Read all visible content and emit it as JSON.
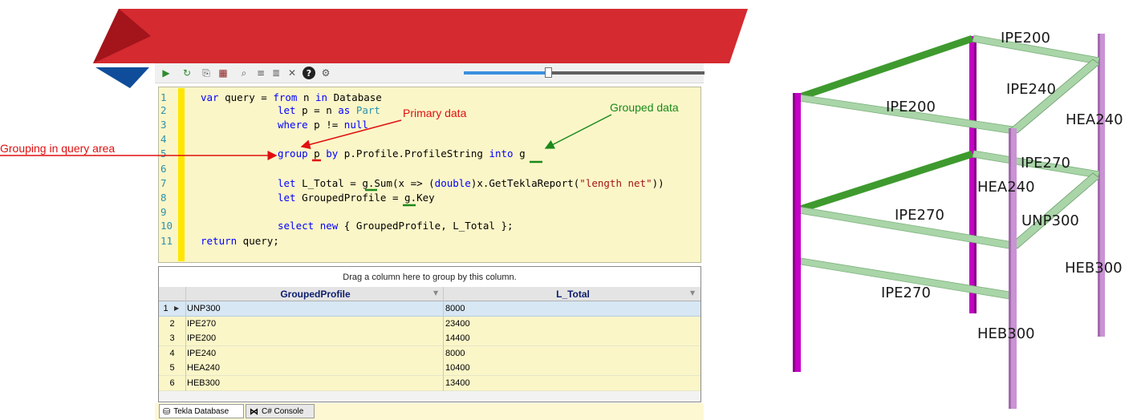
{
  "toolbar": {
    "buttons": [
      {
        "name": "run-icon",
        "glyph": "▶",
        "color": "#2e8b2e"
      },
      {
        "name": "refresh-icon",
        "glyph": "↻",
        "color": "#2e8b2e"
      },
      {
        "name": "export-icon",
        "glyph": "⎘",
        "color": "#555555"
      },
      {
        "name": "table-icon",
        "glyph": "▦",
        "color": "#8b2020"
      },
      {
        "name": "find-icon",
        "glyph": "⌕",
        "color": "#555555"
      },
      {
        "name": "align-icon",
        "glyph": "≡",
        "color": "#555555"
      },
      {
        "name": "comment-icon",
        "glyph": "≣",
        "color": "#555555"
      },
      {
        "name": "clear-icon",
        "glyph": "✕",
        "color": "#555555"
      },
      {
        "name": "help-icon",
        "glyph": "?",
        "color": "#222222"
      },
      {
        "name": "settings-icon",
        "glyph": "⚙",
        "color": "#555555"
      }
    ],
    "zoom_level": 0.35
  },
  "editor": {
    "line_numbers": [
      "1",
      "2",
      "3",
      "4",
      "5",
      "6",
      "7",
      "8",
      "9",
      "10",
      "11"
    ]
  },
  "annotations": {
    "primary": "Primary data",
    "grouped": "Grouped data",
    "grouping": "Grouping in query area"
  },
  "grid": {
    "group_panel_text": "Drag a column here to group by this column.",
    "columns": [
      "GroupedProfile",
      "L_Total"
    ],
    "rows": [
      {
        "num": "1",
        "profile": "UNP300",
        "total": "8000"
      },
      {
        "num": "2",
        "profile": "IPE270",
        "total": "23400"
      },
      {
        "num": "3",
        "profile": "IPE200",
        "total": "14400"
      },
      {
        "num": "4",
        "profile": "IPE240",
        "total": "8000"
      },
      {
        "num": "5",
        "profile": "HEA240",
        "total": "10400"
      },
      {
        "num": "6",
        "profile": "HEB300",
        "total": "13400"
      }
    ]
  },
  "tabs": [
    {
      "label": "Tekla Database",
      "active": true
    },
    {
      "label": "C# Console",
      "active": false
    }
  ],
  "model_labels": [
    "IPE200",
    "IPE240",
    "IPE200",
    "HEA240",
    "IPE270",
    "HEA240",
    "IPE270",
    "UNP300",
    "HEB300",
    "IPE270",
    "HEB300"
  ],
  "colors": {
    "banner_red": "#d42a30",
    "banner_dark_red": "#9a1218",
    "banner_blue": "#0f4d9a",
    "editor_bg": "#fbf6c8",
    "gutter_yellow": "#ffe600",
    "annotation_red": "#e01010",
    "annotation_green": "#1a8a1a",
    "column_magenta": "#c400c4",
    "column_pink": "#c993d4",
    "beam_green": "#3e9a2e",
    "beam_light": "#a9d5a8"
  }
}
